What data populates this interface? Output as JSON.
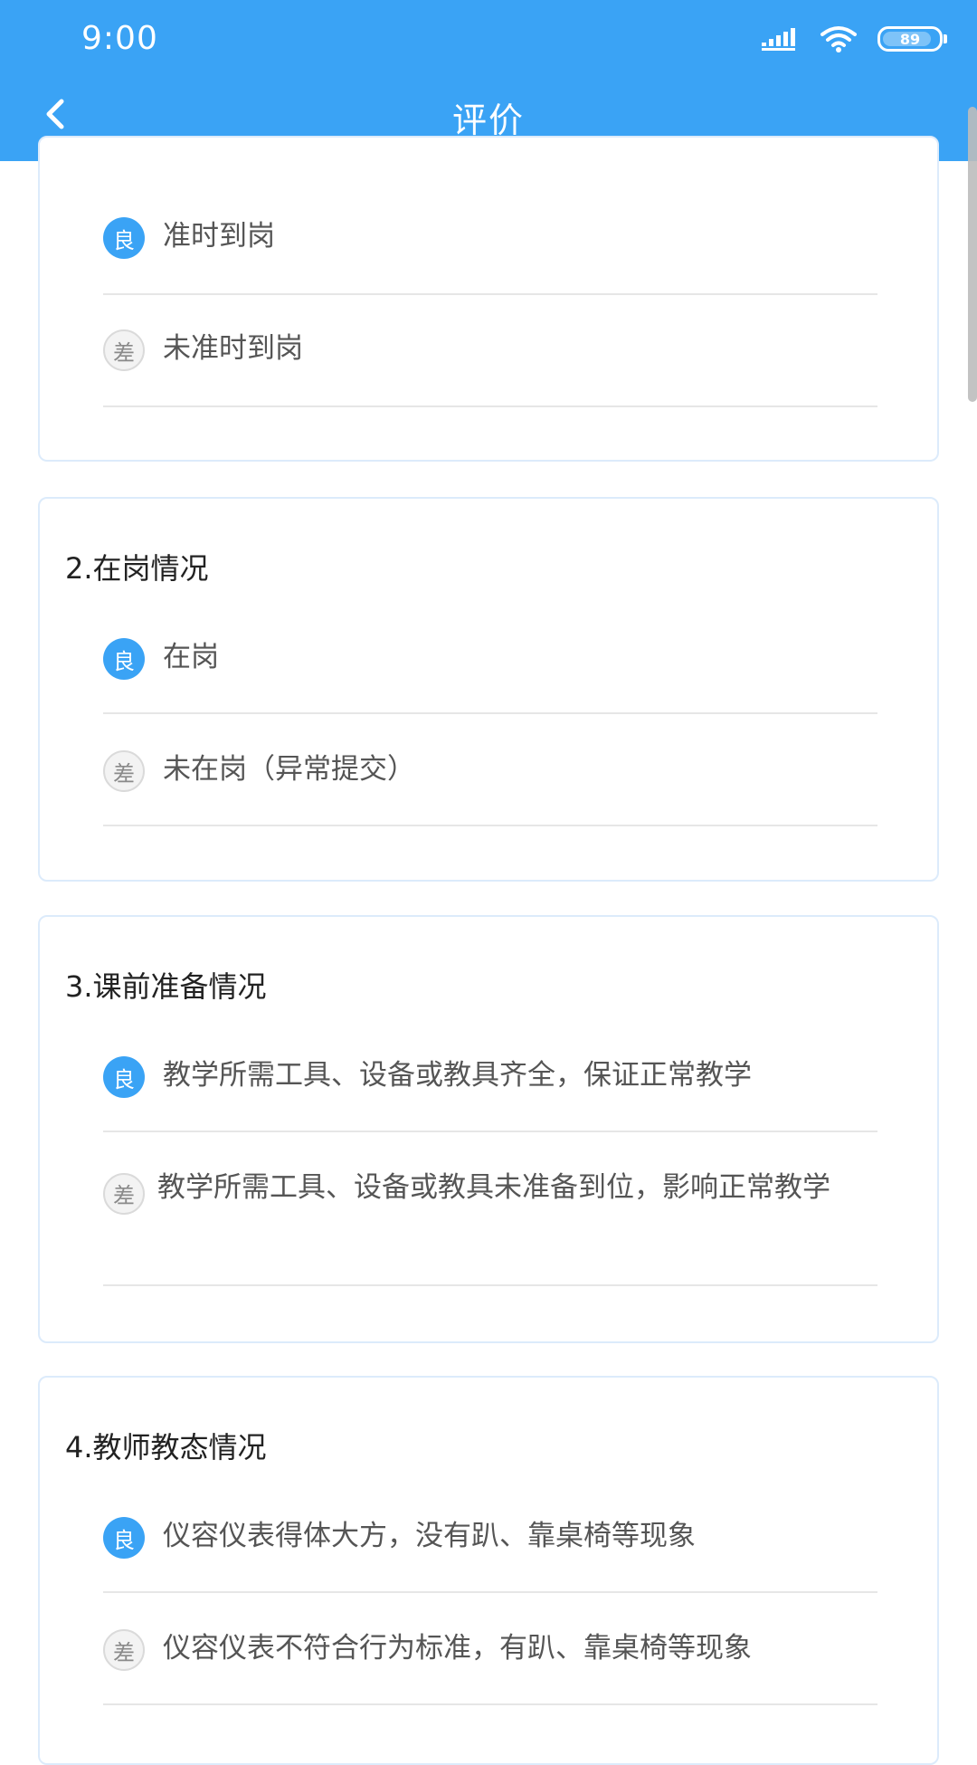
{
  "status_bar": {
    "time": "9:00",
    "battery": "89"
  },
  "header": {
    "title": "评价"
  },
  "badges": {
    "good": "良",
    "bad": "差"
  },
  "sections": [
    {
      "title": "",
      "options": [
        {
          "label": "准时到岗"
        },
        {
          "label": "未准时到岗"
        }
      ]
    },
    {
      "title": "2.在岗情况",
      "options": [
        {
          "label": "在岗"
        },
        {
          "label": "未在岗（异常提交）"
        }
      ]
    },
    {
      "title": "3.课前准备情况",
      "options": [
        {
          "label": "教学所需工具、设备或教具齐全，保证正常教学"
        },
        {
          "label": "教学所需工具、设备或教具未准备到位，影响正常教学"
        }
      ]
    },
    {
      "title": "4.教师教态情况",
      "options": [
        {
          "label": "仪容仪表得体大方，没有趴、靠桌椅等现象"
        },
        {
          "label": "仪容仪表不符合行为标准，有趴、靠桌椅等现象"
        }
      ]
    }
  ]
}
